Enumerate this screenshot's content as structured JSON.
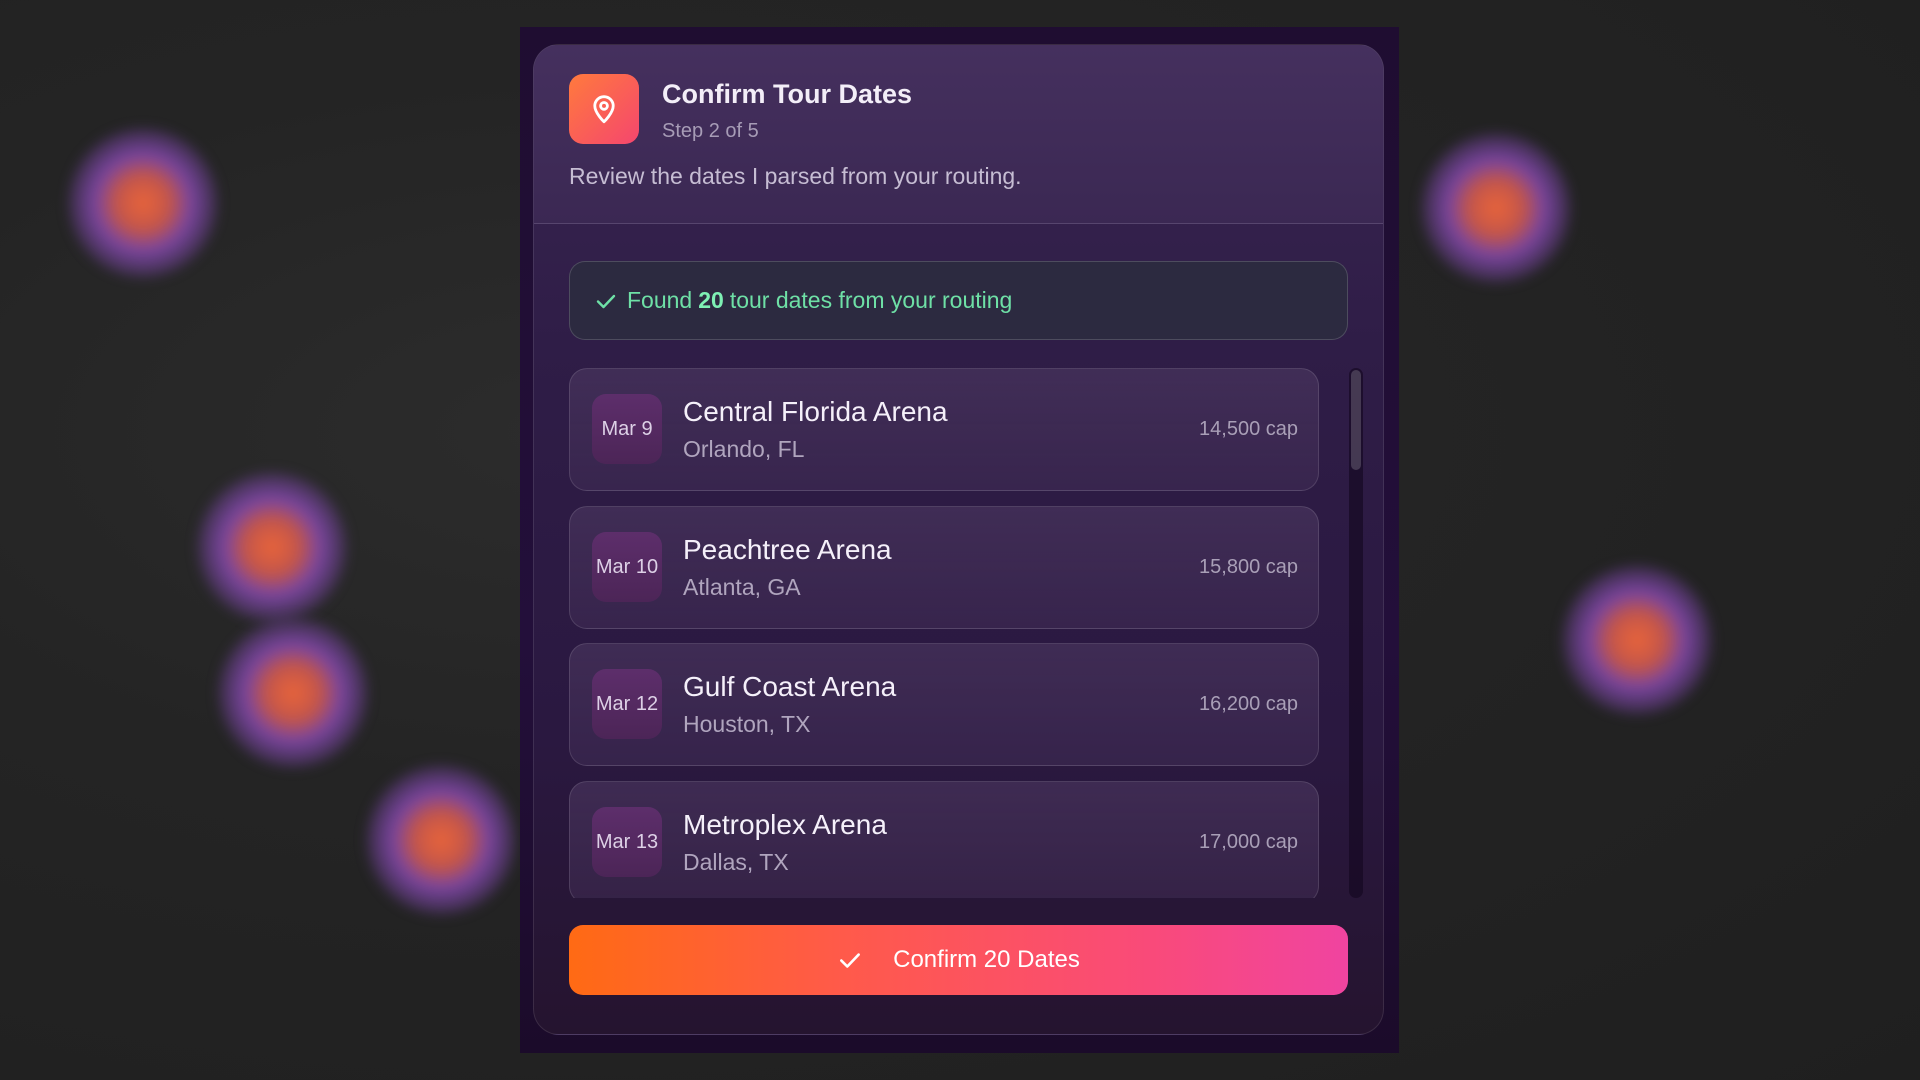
{
  "dialog": {
    "title": "Confirm Tour Dates",
    "step": "Step 2 of 5",
    "description": "Review the dates I parsed from your routing.",
    "icon": "map-pin-icon"
  },
  "banner": {
    "prefix": "Found",
    "count": "20",
    "suffix": "tour dates from your routing",
    "icon": "check-icon"
  },
  "tour_dates": [
    {
      "date": "Mar 9",
      "venue": "Central Florida Arena",
      "city": "Orlando, FL",
      "capacity": "14,500 cap"
    },
    {
      "date": "Mar 10",
      "venue": "Peachtree Arena",
      "city": "Atlanta, GA",
      "capacity": "15,800 cap"
    },
    {
      "date": "Mar 12",
      "venue": "Gulf Coast Arena",
      "city": "Houston, TX",
      "capacity": "16,200 cap"
    },
    {
      "date": "Mar 13",
      "venue": "Metroplex Arena",
      "city": "Dallas, TX",
      "capacity": "17,000 cap"
    }
  ],
  "confirm_button": {
    "label": "Confirm 20 Dates",
    "icon": "check-icon"
  },
  "colors": {
    "accent_orange": "#ff6a14",
    "accent_pink": "#f044a0",
    "success_green": "#6ee0a6"
  }
}
